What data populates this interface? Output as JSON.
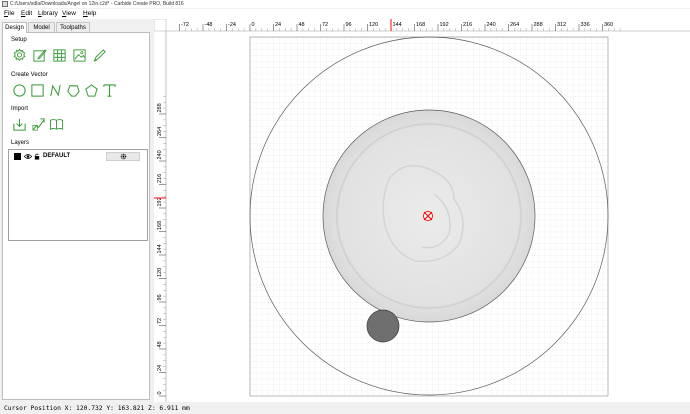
{
  "window": {
    "title": "C:/Users/sdla/Downloads/Angel on 12in.c2d* - Carbide Create PRO, Build 816"
  },
  "menu": {
    "items": [
      "File",
      "Edit",
      "Library",
      "View",
      "Help"
    ]
  },
  "tabs": {
    "items": [
      {
        "label": "Design",
        "active": true
      },
      {
        "label": "Model",
        "active": false
      },
      {
        "label": "Toolpaths",
        "active": false
      }
    ]
  },
  "sections": {
    "setup": "Setup",
    "create_vector": "Create Vector",
    "import": "Import",
    "layers": "Layers"
  },
  "tools": {
    "setup": [
      "job-setup-icon",
      "edit-vector-icon",
      "grid-icon",
      "image-icon",
      "draw-icon"
    ],
    "create_vector": [
      "circle-icon",
      "rectangle-icon",
      "curve-icon",
      "polygon-icon",
      "pentagon-icon",
      "text-icon"
    ],
    "import": [
      "import-icon",
      "trace-image-icon",
      "library-book-icon"
    ]
  },
  "layers": {
    "items": [
      {
        "name": "DEFAULT",
        "color": "#000000"
      }
    ]
  },
  "canvas": {
    "x_ticks": [
      "-72",
      "-48",
      "-24",
      "0",
      "24",
      "48",
      "72",
      "96",
      "120",
      "144",
      "168",
      "192",
      "216",
      "240",
      "264",
      "288",
      "312",
      "336",
      "360"
    ],
    "y_ticks": [
      "288",
      "264",
      "240",
      "216",
      "192",
      "168",
      "144",
      "120",
      "96",
      "72",
      "48",
      "24",
      "0"
    ],
    "accent_color": "#ff0000"
  },
  "status": {
    "text": "Cursor Position X: 120.732 Y: 163.821 Z: 6.911 mm"
  },
  "colors": {
    "tool_green": "#3a9b3a",
    "grid_line": "#e3e3e3",
    "stock_fill": "#e4e4e4",
    "small_circle": "#6f6f6f"
  }
}
